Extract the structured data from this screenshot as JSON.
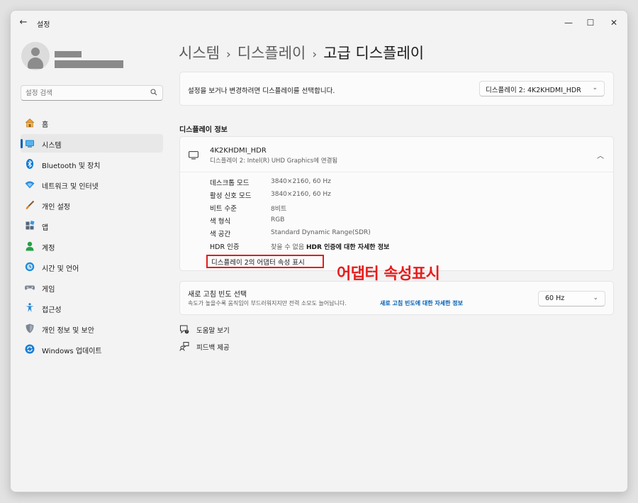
{
  "window": {
    "title": "설정",
    "back_glyph": "←",
    "min_glyph": "—",
    "max_glyph": "☐",
    "close_glyph": "✕"
  },
  "sidebar": {
    "search_placeholder": "설정 검색",
    "items": [
      {
        "label": "홈",
        "icon": "home-icon"
      },
      {
        "label": "시스템",
        "icon": "system-icon",
        "active": true
      },
      {
        "label": "Bluetooth 및 장치",
        "icon": "bluetooth-icon"
      },
      {
        "label": "네트워크 및 인터넷",
        "icon": "network-icon"
      },
      {
        "label": "개인 설정",
        "icon": "personalization-brush-icon"
      },
      {
        "label": "앱",
        "icon": "apps-icon"
      },
      {
        "label": "계정",
        "icon": "account-icon"
      },
      {
        "label": "시간 및 언어",
        "icon": "time-language-icon"
      },
      {
        "label": "게임",
        "icon": "gaming-controller-icon"
      },
      {
        "label": "접근성",
        "icon": "accessibility-icon"
      },
      {
        "label": "개인 정보 및 보안",
        "icon": "privacy-shield-icon"
      },
      {
        "label": "Windows 업데이트",
        "icon": "windows-update-icon"
      }
    ]
  },
  "breadcrumb": {
    "items": [
      "시스템",
      "디스플레이",
      "고급 디스플레이"
    ],
    "separator": "›"
  },
  "display_select": {
    "prompt": "설정을 보거나 변경하려면 디스플레이를 선택합니다.",
    "value": "디스플레이 2: 4K2KHDMI_HDR",
    "chevron": "⌄"
  },
  "display_info": {
    "heading": "디스플레이 정보",
    "name": "4K2KHDMI_HDR",
    "subtitle": "디스플레이 2: Intel(R) UHD Graphics에 연결됨",
    "collapse_glyph": "︿",
    "rows": [
      {
        "key": "데스크톱 모드",
        "value": "3840×2160, 60 Hz"
      },
      {
        "key": "활성 신호 모드",
        "value": "3840×2160, 60 Hz"
      },
      {
        "key": "비트 수준",
        "value": "8비트"
      },
      {
        "key": "색 형식",
        "value": "RGB"
      },
      {
        "key": "색 공간",
        "value": "Standard Dynamic Range(SDR)"
      },
      {
        "key": "HDR 인증",
        "value": "찾을 수 없음",
        "link": "HDR 인증에 대한 자세한 정보"
      }
    ],
    "adapter_link": "디스플레이 2의 어댑터 속성 표시"
  },
  "annotation": {
    "text": "어댑터 속성표시",
    "color": "#e81c1c"
  },
  "refresh_rate": {
    "title": "새로 고침 빈도 선택",
    "description": "속도가 높을수록 움직임이 부드러워지지만 전력 소모도 늘어납니다.",
    "link": "새로 고침 빈도에 대한 자세한 정보",
    "value": "60 Hz",
    "chevron": "⌄"
  },
  "footer": {
    "help": "도움말 보기",
    "feedback": "피드백 제공"
  },
  "colors": {
    "accent": "#005fb8",
    "highlight_box": "#e11d1d"
  }
}
